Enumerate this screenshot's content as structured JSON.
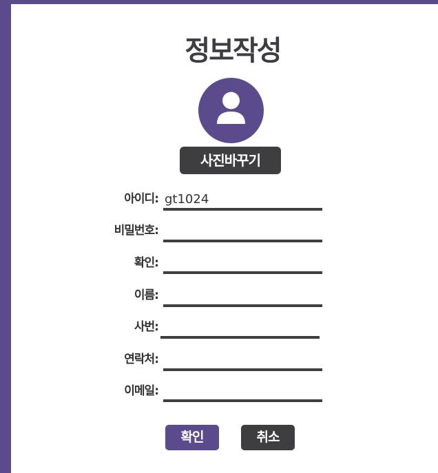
{
  "form": {
    "title": "정보작성",
    "change_photo_label": "사진바꾸기"
  },
  "avatar": {
    "icon": "user-icon",
    "color": "#5b4a8c"
  },
  "fields": {
    "id": {
      "label": "아이디:",
      "value": "gt1024"
    },
    "password": {
      "label": "비밀번호:",
      "value": ""
    },
    "confirm": {
      "label": "확인:",
      "value": ""
    },
    "name": {
      "label": "이름:",
      "value": ""
    },
    "employee_no": {
      "label": "사번:",
      "value": ""
    },
    "phone": {
      "label": "연락처:",
      "value": ""
    },
    "email": {
      "label": "이메일:",
      "value": ""
    }
  },
  "buttons": {
    "confirm_label": "확인",
    "cancel_label": "취소"
  },
  "colors": {
    "accent": "#5b4a8c",
    "dark": "#3e3e40"
  }
}
